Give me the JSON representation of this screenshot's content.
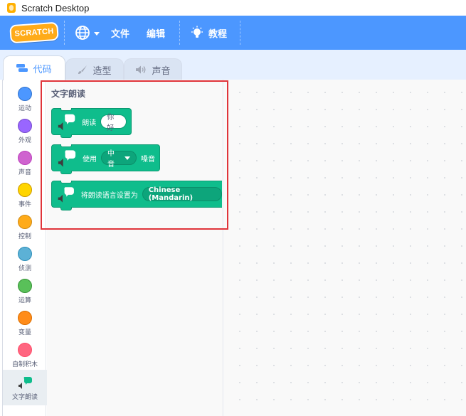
{
  "window": {
    "title": "Scratch Desktop"
  },
  "menubar": {
    "logo_text": "SCRATCH",
    "language_icon": "globe-icon",
    "file_label": "文件",
    "edit_label": "编辑",
    "tutorials_label": "教程",
    "tutorials_icon": "lightbulb-icon",
    "background_color": "#4c97ff"
  },
  "tabs": [
    {
      "label": "代码",
      "icon": "code-icon",
      "active": true
    },
    {
      "label": "造型",
      "icon": "brush-icon",
      "active": false
    },
    {
      "label": "声音",
      "icon": "speaker-icon",
      "active": false
    }
  ],
  "categories": [
    {
      "label": "运动",
      "color": "#4c97ff"
    },
    {
      "label": "外观",
      "color": "#9966ff"
    },
    {
      "label": "声音",
      "color": "#cf63cf"
    },
    {
      "label": "事件",
      "color": "#ffd500"
    },
    {
      "label": "控制",
      "color": "#ffab19"
    },
    {
      "label": "侦测",
      "color": "#5cb1d6"
    },
    {
      "label": "运算",
      "color": "#59c059"
    },
    {
      "label": "变量",
      "color": "#ff8c1a"
    },
    {
      "label": "自制积木",
      "color": "#ff6680"
    },
    {
      "label": "文字朗读",
      "color": "#0fbd8c",
      "selected": true
    }
  ],
  "palette": {
    "section_title": "文字朗读",
    "blocks": {
      "speak": {
        "label": "朗读",
        "input": "你好"
      },
      "voice": {
        "label_before": "使用",
        "dropdown": "中音",
        "label_after": "嗓音"
      },
      "language": {
        "label": "将朗读语言设置为",
        "dropdown": "Chinese (Mandarin)"
      }
    },
    "block_color": "#0fbd8c"
  },
  "annotation": {
    "highlight_color": "#e0343a"
  }
}
